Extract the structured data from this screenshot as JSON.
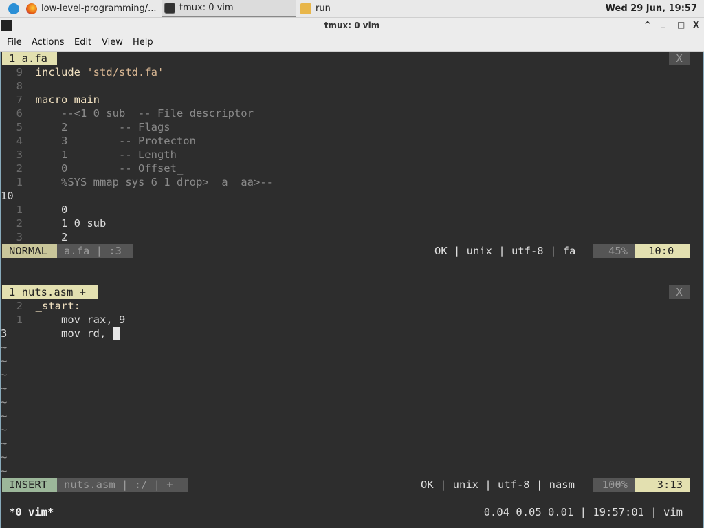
{
  "taskbar": {
    "items": [
      {
        "label": "low-level-programming/..."
      },
      {
        "label": "tmux: 0 vim"
      },
      {
        "label": "run"
      }
    ],
    "clock": "Wed 29 Jun, 19:57"
  },
  "window": {
    "title": "tmux: 0 vim",
    "controls": [
      "^",
      "_",
      "□",
      "X"
    ]
  },
  "menu": [
    "File",
    "Actions",
    "Edit",
    "View",
    "Help"
  ],
  "top_pane": {
    "tab": "1 a.fa",
    "close": "X",
    "lines": [
      {
        "n": "9",
        "code": "include 'std/std.fa'"
      },
      {
        "n": "8",
        "code": ""
      },
      {
        "n": "7",
        "code": "macro main"
      },
      {
        "n": "6",
        "code": "    --<1 0 sub  -- File descriptor"
      },
      {
        "n": "5",
        "code": "    2        -- Flags"
      },
      {
        "n": "4",
        "code": "    3        -- Protecton"
      },
      {
        "n": "3",
        "code": "    1        -- Length"
      },
      {
        "n": "2",
        "code": "    0        -- Offset_"
      },
      {
        "n": "1",
        "code": "    %SYS_mmap sys 6 1 drop>__a__aa>--"
      },
      {
        "n": "10",
        "code": ""
      },
      {
        "n": "1",
        "code": "    0"
      },
      {
        "n": "2",
        "code": "    1 0 sub"
      },
      {
        "n": "3",
        "code": "    2"
      }
    ],
    "status": {
      "mode": "NORMAL",
      "file": "a.fa | :3",
      "info": "OK | unix | utf-8 | fa",
      "percent": "45%",
      "position": "10:0"
    }
  },
  "bottom_pane": {
    "tab": "1 nuts.asm +",
    "close": "X",
    "lines": [
      {
        "n": "2",
        "code": "_start:"
      },
      {
        "n": "1",
        "code": "    mov rax, 9"
      },
      {
        "n": "3",
        "code": "    mov rd, "
      }
    ],
    "tildes": 10,
    "status": {
      "mode": "INSERT",
      "file": "nuts.asm | :/ | +",
      "info": "OK | unix | utf-8 | nasm",
      "percent": "100%",
      "position": "3:13"
    }
  },
  "tmux_bar": {
    "left": "*0 vim*",
    "right": "0.04 0.05 0.01 | 19:57:01 | vim"
  },
  "colors": {
    "background": "#2d2d2d",
    "tab_active": "#e3e0b0",
    "mode_normal": "#c9c69a",
    "mode_insert": "#9cb79a"
  }
}
